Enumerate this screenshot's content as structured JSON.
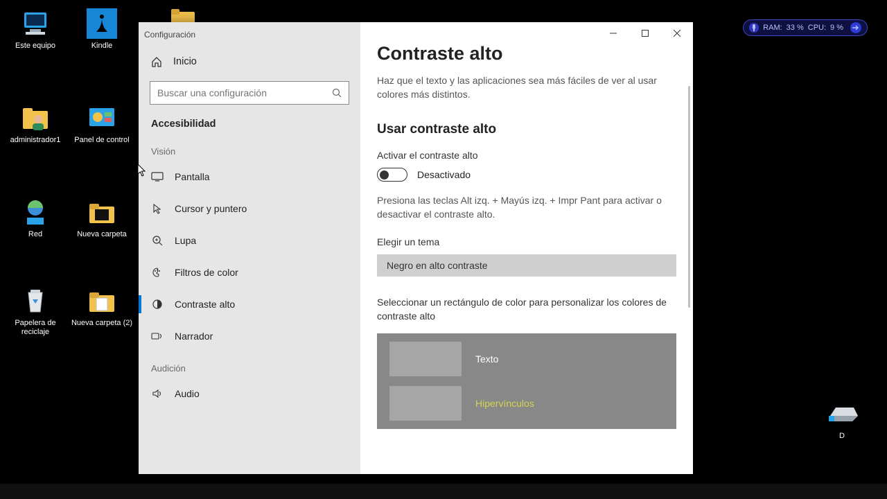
{
  "desktop_icons": [
    {
      "label": "Este equipo",
      "icon": "pc"
    },
    {
      "label": "Kindle",
      "icon": "kindle"
    },
    {
      "label": "administrador1",
      "icon": "userfolder"
    },
    {
      "label": "Panel de control",
      "icon": "controlpanel"
    },
    {
      "label": "Red",
      "icon": "network"
    },
    {
      "label": "Nueva carpeta",
      "icon": "folder"
    },
    {
      "label": "Papelera de reciclaje",
      "icon": "recycle"
    },
    {
      "label": "Nueva carpeta (2)",
      "icon": "folder"
    },
    {
      "label": "",
      "icon": "folder"
    },
    {
      "label": "D",
      "icon": "drive"
    }
  ],
  "perf": {
    "ram_label": "RAM:",
    "ram_value": "33 %",
    "cpu_label": "CPU:",
    "cpu_value": "9 %"
  },
  "window": {
    "title": "Configuración",
    "home": "Inicio",
    "search_placeholder": "Buscar una configuración",
    "category": "Accesibilidad",
    "group_vision": "Visión",
    "group_hearing": "Audición",
    "nav": [
      {
        "label": "Pantalla",
        "icon": "display"
      },
      {
        "label": "Cursor y puntero",
        "icon": "cursor"
      },
      {
        "label": "Lupa",
        "icon": "magnifier"
      },
      {
        "label": "Filtros de color",
        "icon": "palette"
      },
      {
        "label": "Contraste alto",
        "icon": "contrast"
      },
      {
        "label": "Narrador",
        "icon": "narrator"
      }
    ],
    "nav_audio": {
      "label": "Audio",
      "icon": "audio"
    }
  },
  "content": {
    "title": "Contraste alto",
    "description": "Haz que el texto y las aplicaciones sea más fáciles de ver al usar colores más distintos.",
    "section_title": "Usar contraste alto",
    "toggle_label": "Activar el contraste alto",
    "toggle_state": "Desactivado",
    "hint": "Presiona las teclas Alt izq. + Mayús izq. + Impr Pant para activar o desactivar el contraste alto.",
    "theme_label": "Elegir un tema",
    "theme_selected": "Negro en alto contraste",
    "rect_desc": "Seleccionar un rectángulo de color para personalizar los colores de contraste alto",
    "swatches": [
      {
        "label": "Texto",
        "class": "txt-white"
      },
      {
        "label": "Hipervínculos",
        "class": "txt-link"
      }
    ]
  }
}
